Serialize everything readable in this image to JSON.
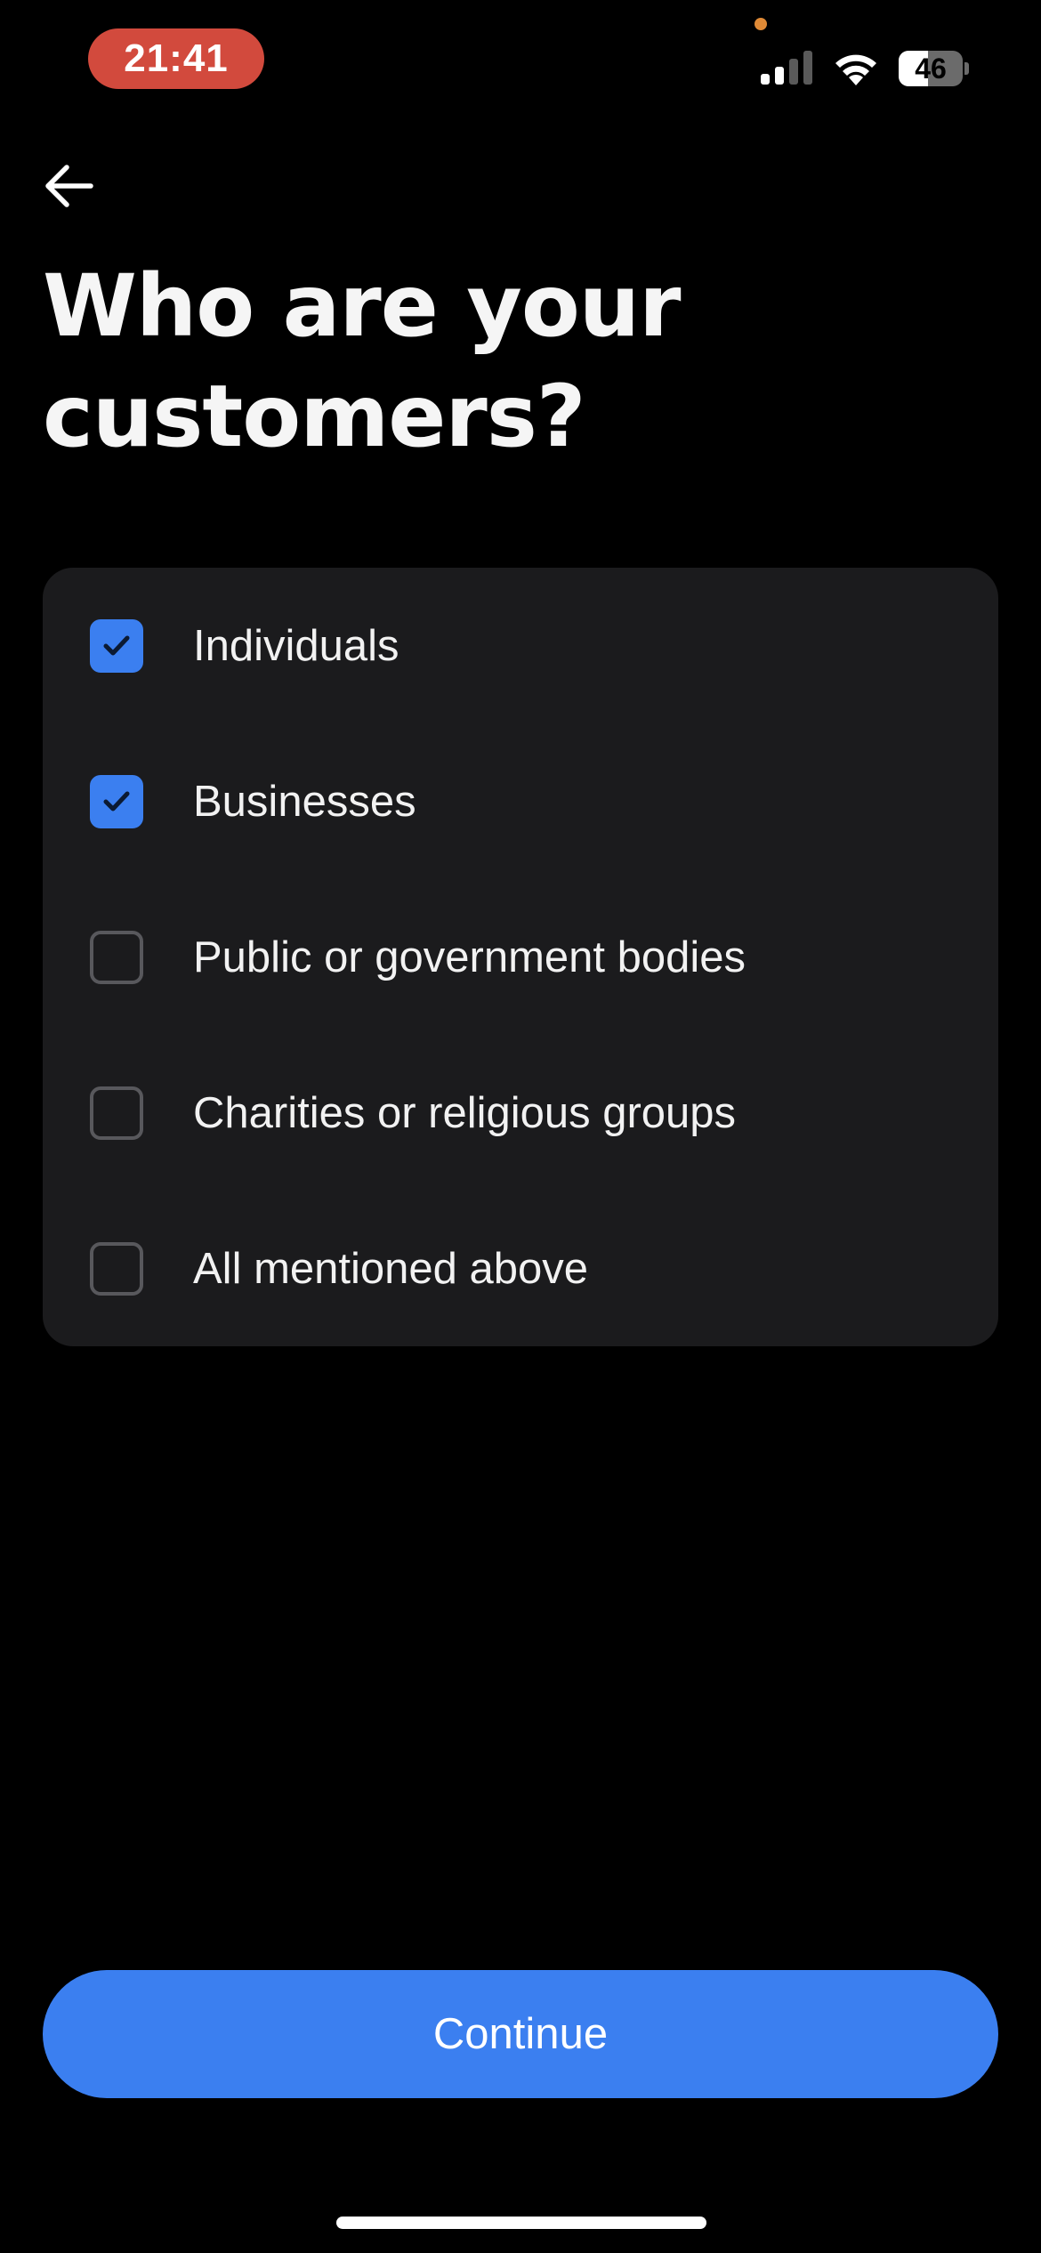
{
  "status_bar": {
    "time": "21:41",
    "battery_level": "46",
    "battery_fraction": 0.46,
    "time_pill_color": "#d24a3d",
    "icons": [
      "signal-icon",
      "wifi-icon",
      "battery-icon"
    ]
  },
  "header": {
    "back_icon": "arrow-left-icon",
    "title": "Who are your customers?"
  },
  "options": [
    {
      "label": "Individuals",
      "checked": true
    },
    {
      "label": "Businesses",
      "checked": true
    },
    {
      "label": "Public or government bodies",
      "checked": false
    },
    {
      "label": "Charities or religious groups",
      "checked": false
    },
    {
      "label": "All mentioned above",
      "checked": false
    }
  ],
  "footer": {
    "continue_label": "Continue"
  },
  "colors": {
    "background": "#000000",
    "card": "#1b1b1d",
    "accent": "#3b7ff0",
    "text": "#f2f2f2"
  }
}
